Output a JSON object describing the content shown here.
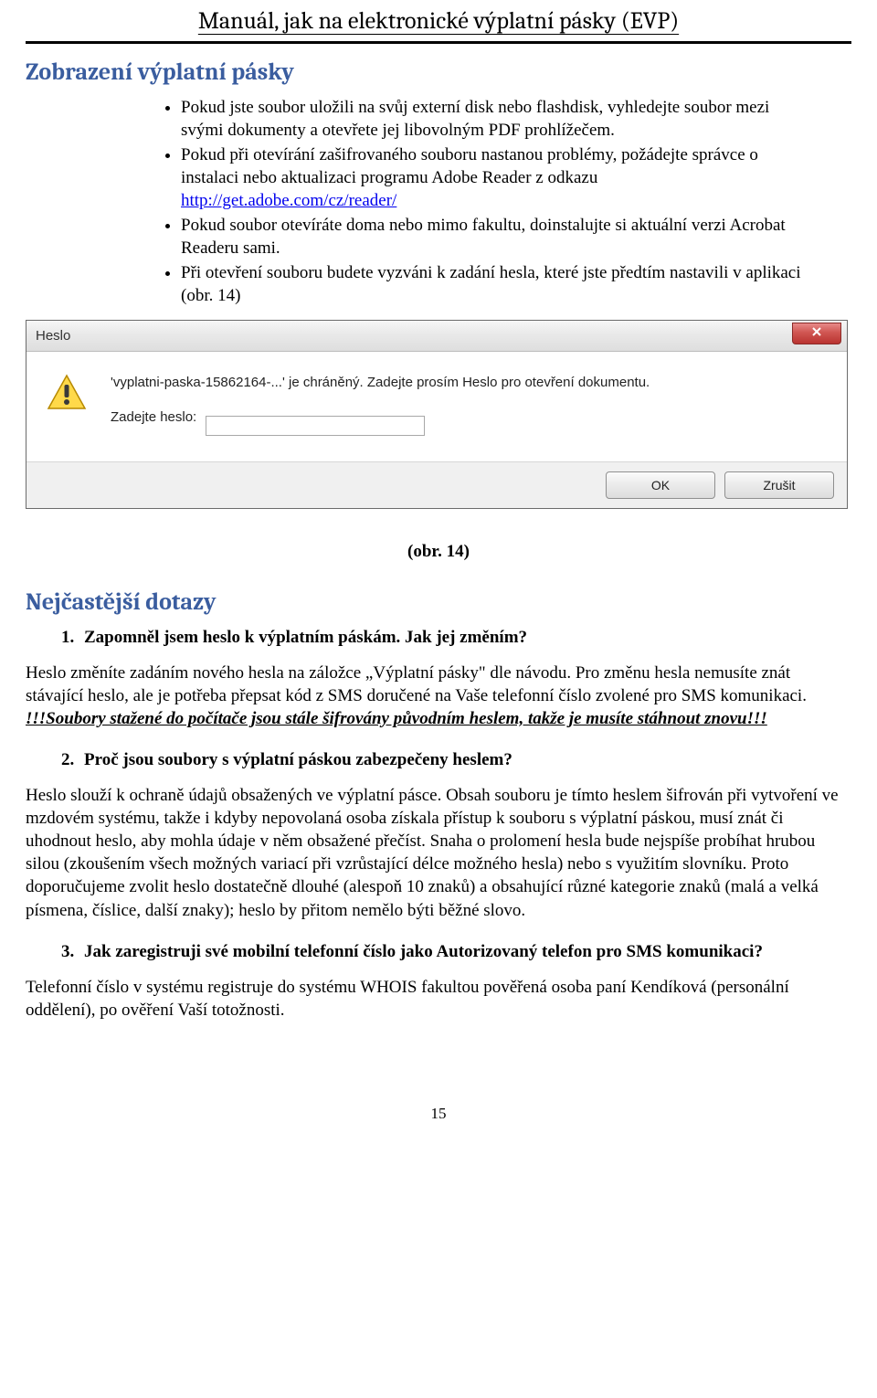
{
  "header": {
    "title": "Manuál, jak na elektronické výplatní pásky (EVP)"
  },
  "section_a": {
    "heading": "Zobrazení výplatní pásky",
    "bullets": [
      {
        "text_before_link": "Pokud jste soubor uložili na svůj externí disk nebo flashdisk, vyhledejte soubor mezi svými dokumenty a otevřete jej libovolným PDF prohlížečem."
      },
      {
        "text_before_link": "Pokud při otevírání zašifrovaného souboru nastanou problémy, požádejte správce o instalaci nebo aktualizaci programu Adobe Reader z odkazu ",
        "link": "http://get.adobe.com/cz/reader/"
      },
      {
        "text_before_link": "Pokud soubor otevíráte doma nebo mimo fakultu, doinstalujte si aktuální verzi Acrobat Readeru sami."
      },
      {
        "text_before_link": "Při otevření souboru budete vyzváni k zadání hesla, které jste předtím nastavili v aplikaci (obr. 14)"
      }
    ]
  },
  "dialog": {
    "title": "Heslo",
    "message": "'vyplatni-paska-15862164-...' je chráněný. Zadejte prosím Heslo pro otevření dokumentu.",
    "input_label": "Zadejte heslo:",
    "ok": "OK",
    "cancel": "Zrušit"
  },
  "caption": "(obr. 14)",
  "faq": {
    "heading": "Nejčastější dotazy",
    "q1": "Zapomněl jsem heslo k výplatním páskám. Jak jej změním?",
    "a1_plain": "Heslo změníte zadáním nového hesla na záložce „Výplatní pásky\" dle návodu. Pro změnu hesla nemusíte znát stávající heslo, ale je potřeba přepsat kód z SMS doručené na Vaše telefonní číslo zvolené pro SMS komunikaci. ",
    "a1_em": "!!!Soubory stažené do počítače jsou stále šifrovány původním heslem, takže je musíte stáhnout znovu!!!",
    "q2": "Proč jsou soubory s výplatní páskou zabezpečeny heslem?",
    "a2": "Heslo slouží k ochraně údajů obsažených ve výplatní pásce. Obsah souboru je tímto heslem šifrován při vytvoření ve mzdovém systému, takže i kdyby nepovolaná osoba získala přístup k souboru s výplatní páskou, musí znát či uhodnout heslo, aby mohla údaje v něm obsažené přečíst. Snaha o prolomení hesla bude nejspíše probíhat hrubou silou (zkoušením všech možných variací při vzrůstající délce možného hesla) nebo s využitím slovníku. Proto doporučujeme zvolit heslo dostatečně dlouhé (alespoň 10 znaků) a obsahující různé kategorie znaků (malá a velká písmena, číslice, další znaky); heslo by přitom nemělo býti běžné slovo.",
    "q3": "Jak zaregistruji své mobilní telefonní číslo jako Autorizovaný telefon pro SMS komunikaci?",
    "a3": "Telefonní číslo v systému registruje do systému WHOIS fakultou pověřená osoba paní Kendíková (personální oddělení), po ověření Vaší totožnosti."
  },
  "page_number": "15"
}
